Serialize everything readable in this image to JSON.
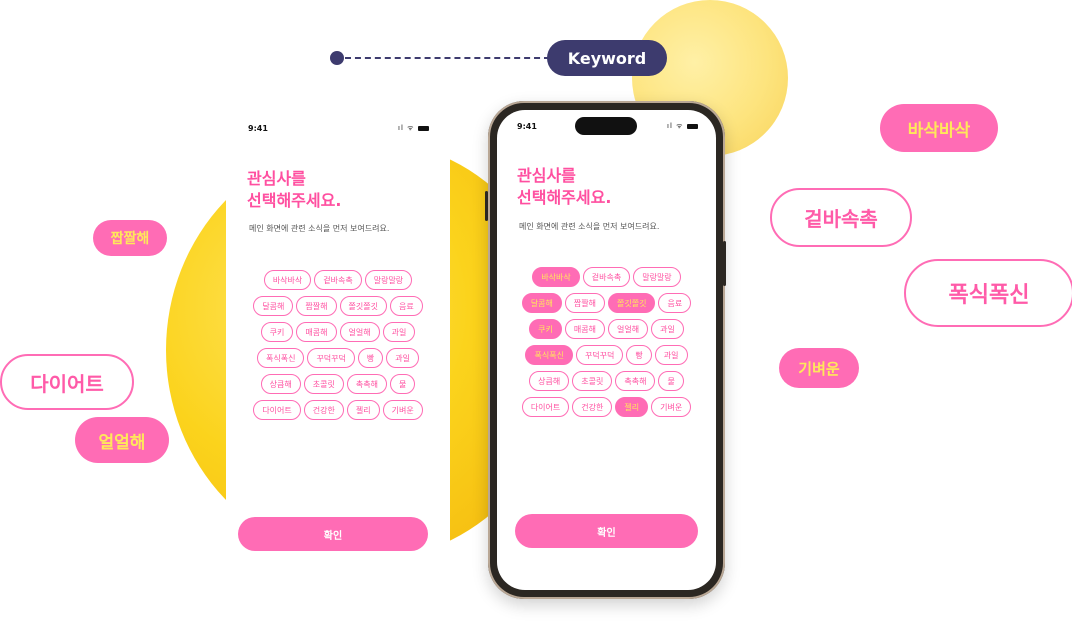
{
  "callout": {
    "label": "Keyword"
  },
  "screen": {
    "time": "9:41",
    "title_line1": "관심사를",
    "title_line2": "선택해주세요.",
    "subtitle": "메인 화면에 관련 소식을 먼저 보여드려요.",
    "confirm_label": "확인",
    "rows": [
      [
        "바삭바삭",
        "겉바속촉",
        "말랑말랑"
      ],
      [
        "달콤해",
        "짭짤해",
        "쫄깃쫄깃",
        "음료"
      ],
      [
        "쿠키",
        "매콤해",
        "얼얼해",
        "과일"
      ],
      [
        "폭식폭신",
        "꾸덕꾸덕",
        "빵",
        "과일"
      ],
      [
        "상큼해",
        "초콜릿",
        "촉촉해",
        "물"
      ],
      [
        "다이어트",
        "건강한",
        "젤리",
        "기벼운"
      ]
    ],
    "selected_right": [
      "바삭바삭",
      "달콤해",
      "쫄깃쫄깃",
      "쿠키",
      "폭식폭신",
      "젤리"
    ]
  },
  "floating_tags": {
    "left": [
      {
        "text": "짭짤해",
        "style": "fill"
      },
      {
        "text": "다이어트",
        "style": "outline"
      },
      {
        "text": "얼얼해",
        "style": "fill"
      }
    ],
    "right": [
      {
        "text": "바삭바삭",
        "style": "fill"
      },
      {
        "text": "겉바속촉",
        "style": "outline"
      },
      {
        "text": "폭식폭신",
        "style": "outline"
      },
      {
        "text": "기벼운",
        "style": "fill"
      }
    ]
  },
  "colors": {
    "pink": "#ff6cb5",
    "yellow_text": "#ffe85a",
    "navy": "#3d3b6e",
    "circle_yellow": "#fbd31c"
  }
}
